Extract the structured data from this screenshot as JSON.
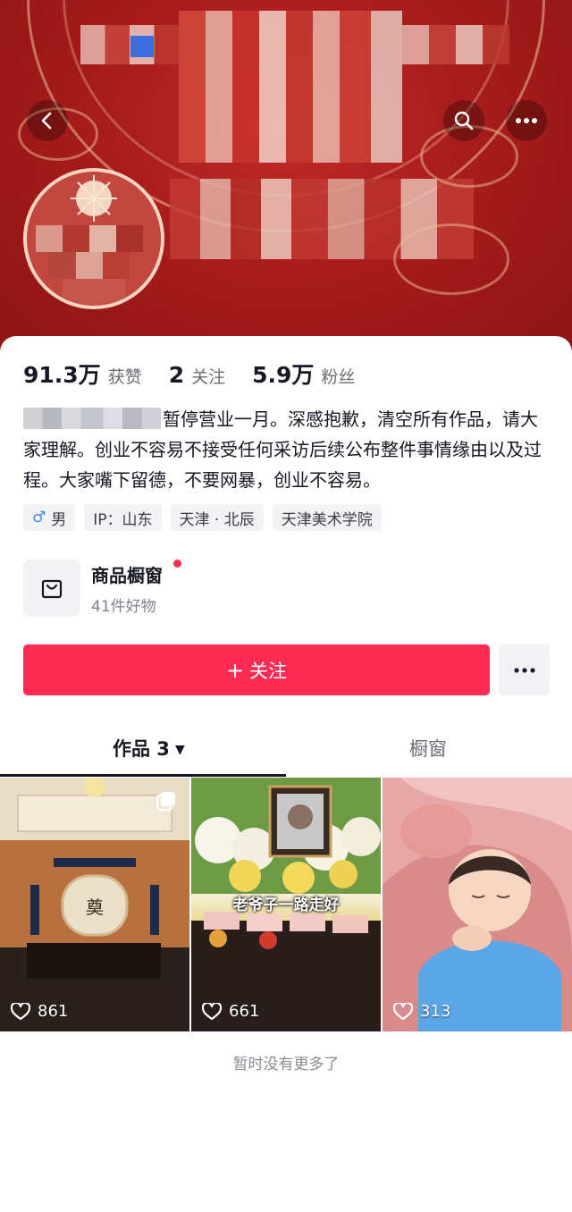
{
  "header": {
    "back_icon": "chevron-left-icon",
    "search_icon": "search-icon",
    "more_icon": "more-horizontal-icon"
  },
  "stats": [
    {
      "value": "91.3万",
      "label": "获赞"
    },
    {
      "value": "2",
      "label": "关注"
    },
    {
      "value": "5.9万",
      "label": "粉丝"
    }
  ],
  "bio": {
    "text": "暂停营业一月。深感抱歉，清空所有作品，请大家理解。创业不容易不接受任何采访后续公布整件事情缘由以及过程。大家嘴下留德，不要网暴，创业不容易。"
  },
  "tags": {
    "gender": "男",
    "ip": "IP：山东",
    "location": "天津 · 北辰",
    "school": "天津美术学院"
  },
  "shop": {
    "title": "商品橱窗",
    "subtitle": "41件好物"
  },
  "actions": {
    "follow_label": "关注",
    "follow_plus": "+",
    "accent_color": "#fe2c55"
  },
  "tabs": {
    "works_label": "作品 3",
    "works_caret": "▼",
    "window_label": "橱窗"
  },
  "videos": [
    {
      "likes": "861",
      "caption": ""
    },
    {
      "likes": "661",
      "caption": "老爷子一路走好"
    },
    {
      "likes": "313",
      "caption": ""
    }
  ],
  "footer": {
    "no_more": "暂时没有更多了"
  }
}
